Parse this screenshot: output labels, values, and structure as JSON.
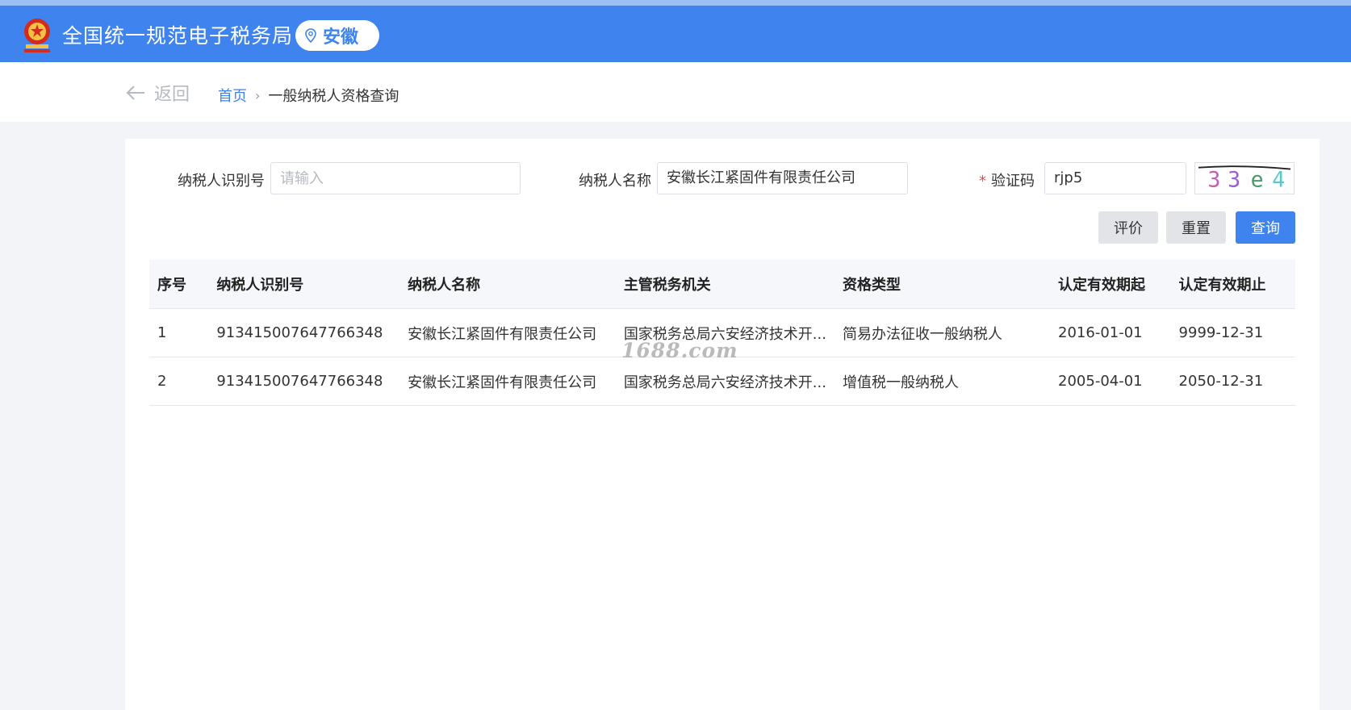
{
  "header": {
    "site_title": "全国统一规范电子税务局",
    "region": "安徽",
    "brand_color": "#3f84ee"
  },
  "nav": {
    "back_label": "返回",
    "breadcrumb_home": "首页",
    "breadcrumb_separator": "›",
    "breadcrumb_current": "一般纳税人资格查询"
  },
  "form": {
    "taxpayer_id_label": "纳税人识别号",
    "taxpayer_id_placeholder": "请输入",
    "taxpayer_id_value": "",
    "taxpayer_name_label": "纳税人名称",
    "taxpayer_name_value": "安徽长江紧固件有限责任公司",
    "captcha_label": "验证码",
    "required_mark": "*",
    "captcha_value": "rjp5",
    "captcha_image_chars": [
      "3",
      "3",
      "e",
      "4"
    ]
  },
  "buttons": {
    "evaluate": "评价",
    "reset": "重置",
    "query": "查询"
  },
  "table": {
    "headers": [
      "序号",
      "纳税人识别号",
      "纳税人名称",
      "主管税务机关",
      "资格类型",
      "认定有效期起",
      "认定有效期止"
    ],
    "rows": [
      [
        "1",
        "913415007647766348",
        "安徽长江紧固件有限责任公司",
        "国家税务总局六安经济技术开...",
        "简易办法征收一般纳税人",
        "2016-01-01",
        "9999-12-31"
      ],
      [
        "2",
        "913415007647766348",
        "安徽长江紧固件有限责任公司",
        "国家税务总局六安经济技术开...",
        "增值税一般纳税人",
        "2005-04-01",
        "2050-12-31"
      ]
    ]
  },
  "watermark": "1688.com"
}
